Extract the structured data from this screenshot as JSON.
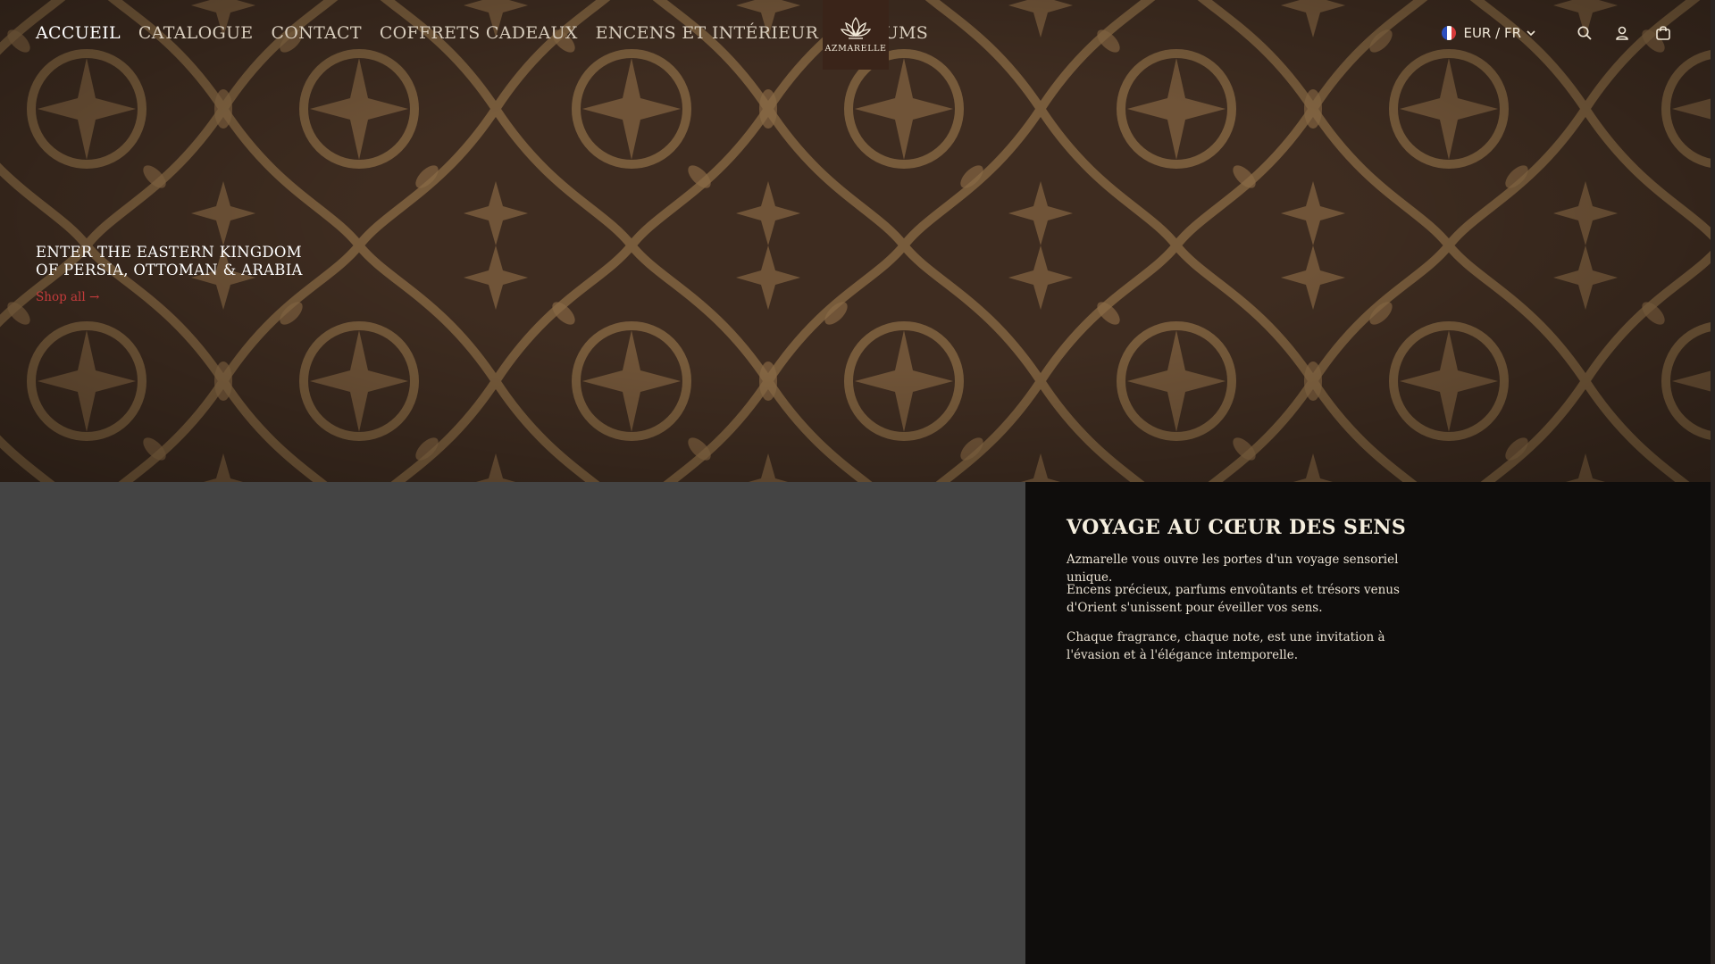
{
  "nav": {
    "links": [
      {
        "label": "ACCUEIL",
        "active": true
      },
      {
        "label": "CATALOGUE",
        "active": false
      },
      {
        "label": "CONTACT",
        "active": false
      },
      {
        "label": "COFFRETS CADEAUX",
        "active": false
      },
      {
        "label": "ENCENS ET INTÉRIEUR",
        "active": false
      },
      {
        "label": "PARFUMS",
        "active": false
      }
    ],
    "logo_text": "AZMARELLE",
    "locale": "EUR / FR",
    "icons": [
      "france-flag-icon",
      "chevron-down-icon",
      "search-icon",
      "account-icon",
      "cart-icon"
    ]
  },
  "hero": {
    "heading_line1": "ENTER THE EASTERN KINGDOM",
    "heading_line2": "OF PERSIA, OTTOMAN & ARABIA",
    "link": "Shop all →"
  },
  "about": {
    "title": "VOYAGE AU CŒUR DES SENS",
    "paragraphs": [
      "Azmarelle vous ouvre les portes d'un voyage sensoriel unique.",
      "Encens précieux, parfums envoûtants et trésors venus d'Orient s'unissent pour éveiller vos sens.",
      "Chaque fragrance, chaque note, est une invitation à l'évasion et à l'élégance intemporelle."
    ]
  },
  "colors": {
    "hero_background": "#3e2c20",
    "pattern": "#8a6a44",
    "logo_background": "#3a2419",
    "link_accent": "#c23b3b",
    "media_placeholder": "#444444",
    "panel_background": "#0f0d0c"
  }
}
